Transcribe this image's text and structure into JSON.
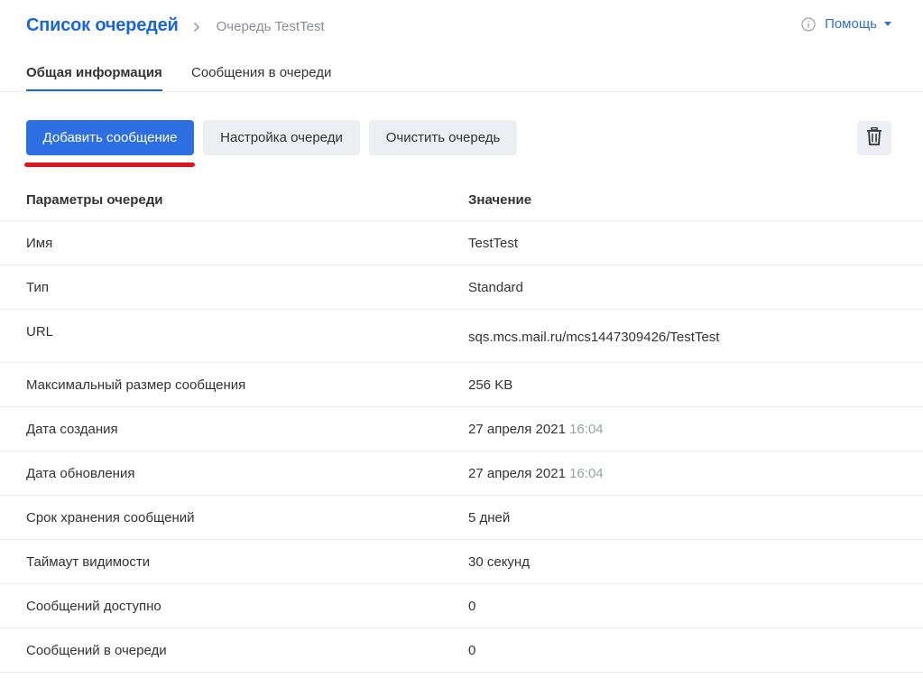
{
  "header": {
    "title": "Список очередей",
    "current": "Очередь TestTest",
    "help_label": "Помощь"
  },
  "tabs": [
    {
      "label": "Общая информация",
      "active": true
    },
    {
      "label": "Сообщения в очереди",
      "active": false
    }
  ],
  "toolbar": {
    "add_label": "Добавить сообщение",
    "settings_label": "Настройка очереди",
    "clear_label": "Очистить очередь",
    "delete_icon": "trash-icon"
  },
  "table": {
    "headers": [
      "Параметры очереди",
      "Значение"
    ],
    "rows": [
      {
        "param": "Имя",
        "value": "TestTest"
      },
      {
        "param": "Тип",
        "value": "Standard"
      },
      {
        "param": "URL",
        "value": "sqs.mcs.mail.ru/mcs1447309426/TestTest"
      },
      {
        "param": "Максимальный размер сообщения",
        "value": "256 KB"
      },
      {
        "param": "Дата создания",
        "value": "27 апреля 2021",
        "time": "16:04"
      },
      {
        "param": "Дата обновления",
        "value": "27 апреля 2021",
        "time": "16:04"
      },
      {
        "param": "Срок хранения сообщений",
        "value": "5 дней"
      },
      {
        "param": "Таймаут видимости",
        "value": "30 секунд"
      },
      {
        "param": "Сообщений доступно",
        "value": "0"
      },
      {
        "param": "Сообщений в очереди",
        "value": "0"
      }
    ]
  },
  "colors": {
    "accent": "#2d6fe3",
    "title": "#1a66d9",
    "highlight": "#e0141e",
    "muted": "#9aa0a6"
  }
}
